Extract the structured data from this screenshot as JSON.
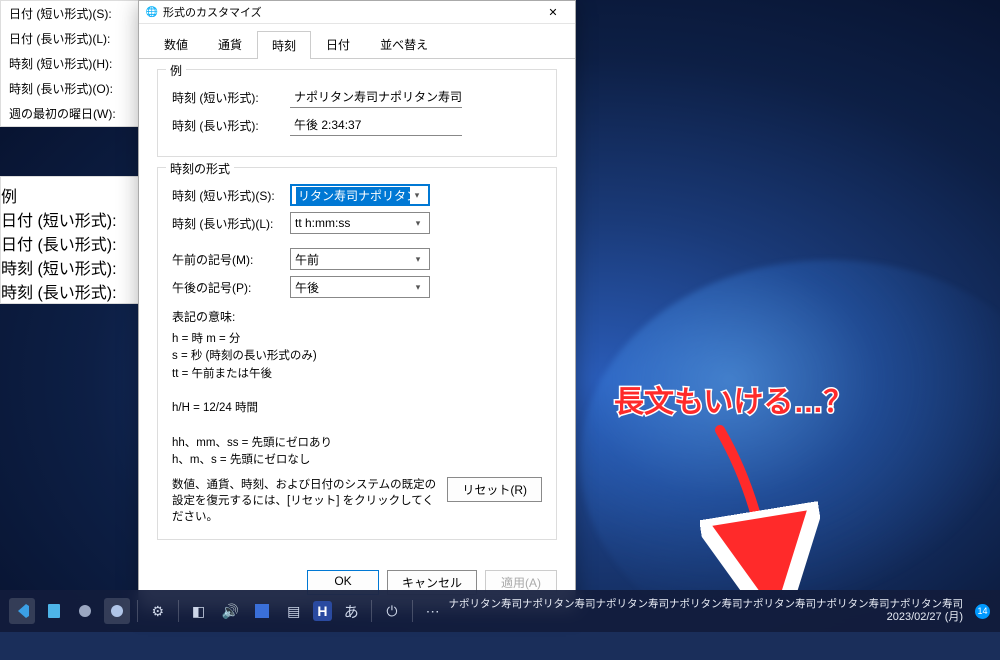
{
  "dialog": {
    "title": "形式のカスタマイズ",
    "tabs": [
      "数値",
      "通貨",
      "時刻",
      "日付",
      "並べ替え"
    ],
    "active_tab": 2,
    "example_group": "例",
    "short_time_label": "時刻 (短い形式):",
    "short_time_value": "ナポリタン寿司ナポリタン寿司",
    "long_time_label": "時刻 (長い形式):",
    "long_time_value": "午後 2:34:37",
    "format_group": "時刻の形式",
    "fmt_short_label": "時刻 (短い形式)(S):",
    "fmt_short_value": "リタン寿司ナポリタン寿司",
    "fmt_long_label": "時刻 (長い形式)(L):",
    "fmt_long_value": "tt h:mm:ss",
    "am_label": "午前の記号(M):",
    "am_value": "午前",
    "pm_label": "午後の記号(P):",
    "pm_value": "午後",
    "notation_title": "表記の意味:",
    "notation_body": "h = 時   m = 分\ns = 秒 (時刻の長い形式のみ)\ntt = 午前または午後\n\nh/H = 12/24 時間\n\nhh、mm、ss = 先頭にゼロあり\nh、m、s = 先頭にゼロなし",
    "reset_text": "数値、通貨、時刻、および日付のシステムの既定の設定を復元するには、[リセット] をクリックしてください。",
    "reset_btn": "リセット(R)",
    "ok": "OK",
    "cancel": "キャンセル",
    "apply": "適用(A)"
  },
  "bg_fields": {
    "r1": "日付 (短い形式)(S):",
    "r2": "日付 (長い形式)(L):",
    "r3": "時刻 (短い形式)(H):",
    "r4": "時刻 (長い形式)(O):",
    "r5": "週の最初の曜日(W):",
    "example": "例",
    "e1": "日付 (短い形式):",
    "e2": "日付 (長い形式):",
    "e3": "時刻 (短い形式):",
    "e4": "時刻 (長い形式):"
  },
  "annotation": "長文もいける…？",
  "taskbar": {
    "clock_line1": "ナポリタン寿司ナポリタン寿司ナポリタン寿司ナポリタン寿司ナポリタン寿司ナポリタン寿司ナポリタン寿司",
    "clock_line2": "2023/02/27 (月)",
    "badge": "14",
    "ime": "あ",
    "h": "H"
  }
}
